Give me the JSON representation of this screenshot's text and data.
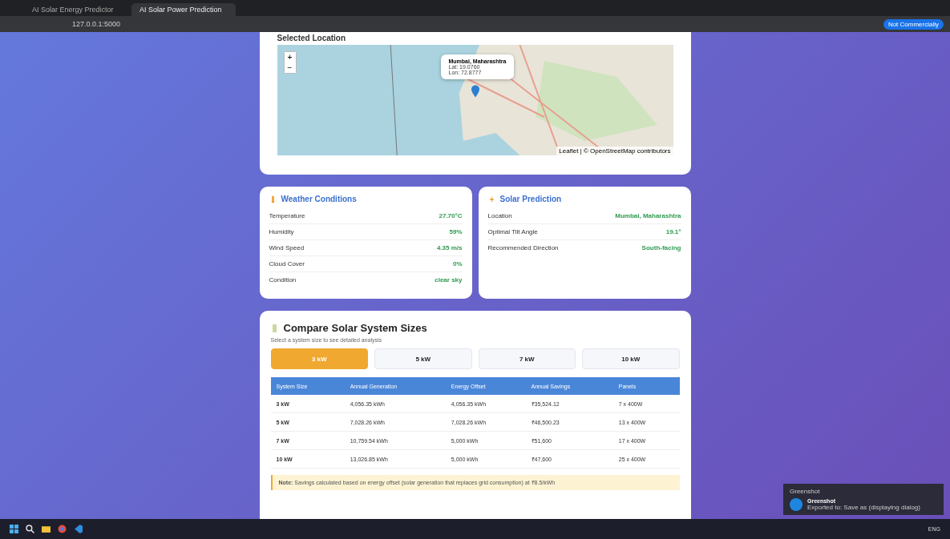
{
  "browser": {
    "tabs": [
      {
        "title": "AI Solar Energy Predictor",
        "selected": false
      },
      {
        "title": "AI Solar Power Prediction",
        "selected": true
      }
    ],
    "address": "127.0.0.1:5000",
    "profile_button": "Not Commercially"
  },
  "map_card": {
    "title": "Selected Location",
    "popup": {
      "name": "Mumbai, Maharashtra",
      "lat": "Lat: 19.0760",
      "lon": "Lon: 72.8777"
    },
    "zoom_in": "+",
    "zoom_out": "−",
    "attribution": "Leaflet | © OpenStreetMap contributors"
  },
  "weather": {
    "title": "Weather Conditions",
    "rows": [
      {
        "label": "Temperature",
        "value": "27.70°C"
      },
      {
        "label": "Humidity",
        "value": "59%"
      },
      {
        "label": "Wind Speed",
        "value": "4.35 m/s"
      },
      {
        "label": "Cloud Cover",
        "value": "0%"
      },
      {
        "label": "Condition",
        "value": "clear sky"
      }
    ]
  },
  "solar": {
    "title": "Solar Prediction",
    "rows": [
      {
        "label": "Location",
        "value": "Mumbai, Maharashtra"
      },
      {
        "label": "Optimal Tilt Angle",
        "value": "19.1°"
      },
      {
        "label": "Recommended Direction",
        "value": "South-facing"
      }
    ]
  },
  "compare": {
    "title": "Compare Solar System Sizes",
    "subtitle": "Select a system size to see detailed analysis",
    "sizes": [
      {
        "label": "3 kW",
        "selected": true
      },
      {
        "label": "5 kW",
        "selected": false
      },
      {
        "label": "7 kW",
        "selected": false
      },
      {
        "label": "10 kW",
        "selected": false
      }
    ],
    "columns": [
      "System Size",
      "Annual Generation",
      "Energy Offset",
      "Annual Savings",
      "Panels"
    ],
    "rows": [
      [
        "3 kW",
        "4,056.35 kWh",
        "4,056.35 kWh",
        "₹35,524.12",
        "7 x 400W"
      ],
      [
        "5 kW",
        "7,028.26 kWh",
        "7,028.26 kWh",
        "₹46,500.23",
        "13 x 400W"
      ],
      [
        "7 kW",
        "10,759.54 kWh",
        "5,000 kWh",
        "₹51,600",
        "17 x 400W"
      ],
      [
        "10 kW",
        "13,026.85 kWh",
        "5,000 kWh",
        "₹47,600",
        "25 x 400W"
      ]
    ],
    "note": {
      "label": "Note:",
      "text": "Savings calculated based on energy offset (solar generation that replaces grid consumption) at ₹8.5/kWh"
    }
  },
  "toast": {
    "app": "Greenshot",
    "title": "Greenshot",
    "message": "Exported to: Save as (displaying dialog)"
  },
  "taskbar": {
    "lang": "ENG"
  }
}
